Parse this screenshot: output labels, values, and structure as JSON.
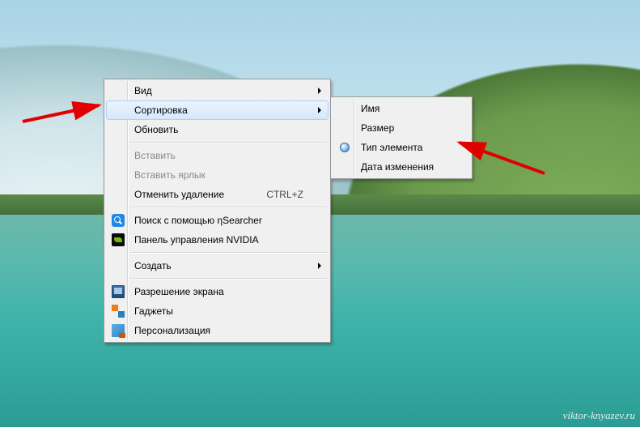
{
  "watermark": "viktor-knyazev.ru",
  "main_menu": {
    "view": "Вид",
    "sort": "Сортировка",
    "refresh": "Обновить",
    "paste": "Вставить",
    "paste_shortcut": "Вставить ярлык",
    "undo_delete": "Отменить удаление",
    "undo_delete_key": "CTRL+Z",
    "nsearcher": "Поиск с помощью ηSearcher",
    "nvidia": "Панель управления NVIDIA",
    "create": "Создать",
    "screen_res": "Разрешение экрана",
    "gadgets": "Гаджеты",
    "personalization": "Персонализация"
  },
  "sort_menu": {
    "name": "Имя",
    "size": "Размер",
    "type": "Тип элемента",
    "date": "Дата изменения"
  }
}
